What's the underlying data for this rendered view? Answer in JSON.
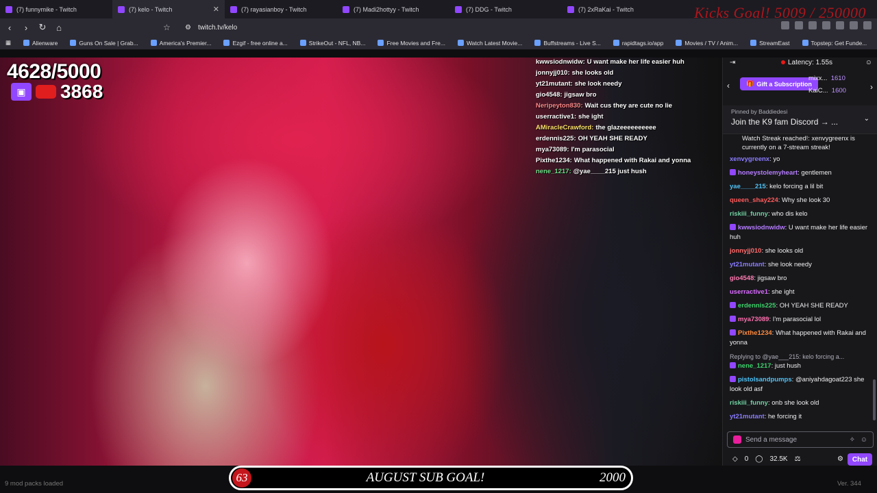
{
  "tabs": [
    {
      "label": "(7) funnymike - Twitch"
    },
    {
      "label": "(7) kelo - Twitch"
    },
    {
      "label": "(7) rayasianboy - Twitch"
    },
    {
      "label": "(7) Madi2hottyy - Twitch"
    },
    {
      "label": "(7) DDG - Twitch"
    },
    {
      "label": "(7) 2xRaKai - Twitch"
    }
  ],
  "kicks_goal": "Kicks Goal! 5009 / 250000",
  "url": "twitch.tv/kelo",
  "bookmarks": [
    "Alienware",
    "Guns On Sale | Grab...",
    "America's Premier...",
    "Ezgif - free online a...",
    "StrikeOut - NFL, NB...",
    "Free Movies and Fre...",
    "Watch Latest Movie...",
    "Buffstreams - Live S...",
    "rapidtags.io/app",
    "Movies / TV / Anim...",
    "StreamEast",
    "Topstep: Get Funde..."
  ],
  "overlay": {
    "follower_count": "4628/5000",
    "sub_count": "3868",
    "chat": [
      {
        "user": "kwwsiodnwidw:",
        "text": "U want make her life easier huh"
      },
      {
        "user": "jonnyjj010:",
        "text": "she looks old"
      },
      {
        "user": "yt21mutant:",
        "text": "she look needy"
      },
      {
        "user": "gio4548:",
        "text": "jigsaw bro"
      },
      {
        "user": "Neripeyton830:",
        "text": "Wait cus they are cute no lie"
      },
      {
        "user": "userractive1:",
        "text": "she ight"
      },
      {
        "user": "AMiracleCrawford:",
        "text": "the glazeeeeeeeeee"
      },
      {
        "user": "erdennis225:",
        "text": "OH YEAH SHE READY"
      },
      {
        "user": "mya73089:",
        "text": "I'm parasocial"
      },
      {
        "user": "Pixthe1234:",
        "text": "What happened with Rakai and yonna"
      },
      {
        "user": "nene_1217:",
        "text": "@yae____215 just hush"
      }
    ]
  },
  "goal_bar": {
    "current": "63",
    "label": "AUGUST SUB GOAL!",
    "target": "2000"
  },
  "status": {
    "mod_packs": "9 mod packs loaded",
    "version": "Ver. 344"
  },
  "chat_panel": {
    "latency": "Latency: 1.55s",
    "gift_label": "Gift a Subscription",
    "leaders": [
      {
        "name": "mixx...",
        "value": "1610"
      },
      {
        "name": "KaiC...",
        "value": "1600"
      }
    ],
    "pinned_by": "Pinned by Baddiedesi",
    "pinned_msg": "Join the K9 fam Discord → ...",
    "streak_text": "Watch Streak reached!: xenvygreenx is currently on a 7-stream streak!",
    "messages": [
      {
        "user": "xenvygreenx",
        "color": "#8a7cff",
        "text": "yo"
      },
      {
        "user": "honeystolemyheart",
        "color": "#b57cff",
        "text": "gentlemen"
      },
      {
        "user": "yae____215",
        "color": "#4fc3f7",
        "text": "kelo forcing a lil bit"
      },
      {
        "user": "queen_shay224",
        "color": "#ff5a5a",
        "text": "Why she look 30"
      },
      {
        "user": "riskiii_funny",
        "color": "#6fd0a0",
        "text": "who dis kelo"
      },
      {
        "user": "kwwsiodnwidw",
        "color": "#b57cff",
        "text": "U want make her life easier huh"
      },
      {
        "user": "jonnyjj010",
        "color": "#ff6b6b",
        "text": "she looks old"
      },
      {
        "user": "yt21mutant",
        "color": "#8a7cff",
        "text": "she look needy"
      },
      {
        "user": "gio4548",
        "color": "#ff7ab0",
        "text": "jigsaw bro"
      },
      {
        "user": "userractive1",
        "color": "#d96bff",
        "text": "she ight"
      },
      {
        "user": "erdennis225",
        "color": "#3dd16b",
        "text": "OH YEAH SHE READY"
      },
      {
        "user": "mya73089",
        "color": "#ff6fae",
        "text": "I'm parasocial lol"
      },
      {
        "user": "Pixthe1234",
        "color": "#ff8a3d",
        "text": "What happened with Rakai and yonna"
      },
      {
        "user": "nene_1217",
        "color": "#3dd16b",
        "text": "just hush",
        "reply": "Replying to @yae___215: kelo forcing a..."
      },
      {
        "user": "pistolsandpumps",
        "color": "#4fc3f7",
        "text": "@aniyahdagoat223 she look old asf"
      },
      {
        "user": "riskiii_funny",
        "color": "#6fd0a0",
        "text": "onb she look old"
      },
      {
        "user": "yt21mutant",
        "color": "#8a7cff",
        "text": "he forcing it"
      }
    ],
    "input_placeholder": "Send a message",
    "points": "0",
    "viewers": "32.5K",
    "chat_button": "Chat"
  }
}
